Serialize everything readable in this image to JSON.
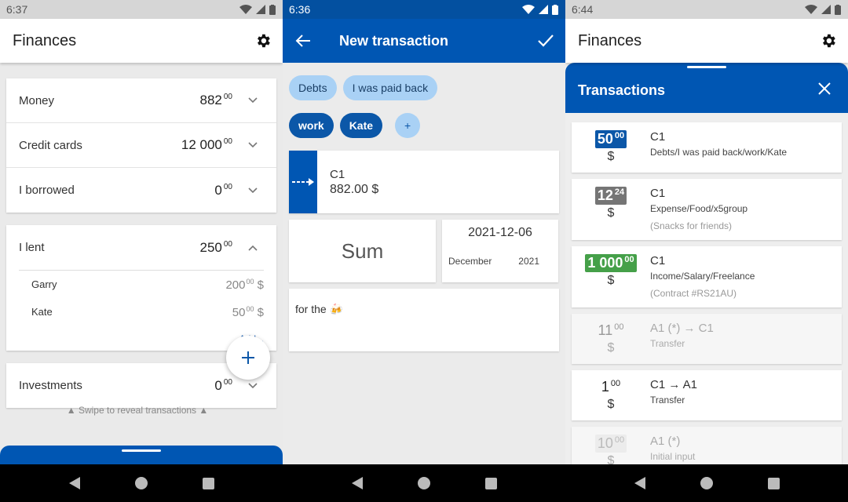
{
  "screen1": {
    "status_time": "6:37",
    "title": "Finances",
    "accounts": [
      {
        "label": "Money",
        "amount": "882",
        "cents": "00"
      },
      {
        "label": "Credit cards",
        "amount": "12 000",
        "cents": "00"
      },
      {
        "label": "I borrowed",
        "amount": "0",
        "cents": "00"
      }
    ],
    "lent": {
      "label": "I lent",
      "amount": "250",
      "cents": "00",
      "items": [
        {
          "name": "Garry",
          "amount": "200",
          "cents": "00",
          "currency": "$"
        },
        {
          "name": "Kate",
          "amount": "50",
          "cents": "00",
          "currency": "$"
        }
      ],
      "add_label": "Add..."
    },
    "investments": {
      "label": "Investments",
      "amount": "0",
      "cents": "00"
    },
    "swipe_hint": "▲ Swipe to reveal transactions ▲",
    "fab_label": "+"
  },
  "screen2": {
    "status_time": "6:36",
    "title": "New transaction",
    "chips_row1": [
      "Debts",
      "I was paid back"
    ],
    "chips_row2": [
      "work",
      "Kate"
    ],
    "chip_add": "+",
    "account_name": "C1",
    "account_balance": "882.00 $",
    "sum_placeholder": "Sum",
    "date": "2021-12-06",
    "month": "December",
    "year": "2021",
    "note": "for the 🍻"
  },
  "screen3": {
    "status_time": "6:44",
    "title": "Finances",
    "sheet_title": "Transactions",
    "transactions": [
      {
        "amount": "50",
        "cents": "00",
        "currency": "$",
        "style": "blue",
        "account": "C1",
        "category": "Debts/I was paid back/work/Kate",
        "note": "",
        "faded": false
      },
      {
        "amount": "12",
        "cents": "24",
        "currency": "$",
        "style": "grey",
        "account": "C1",
        "category": "Expense/Food/x5group",
        "note": "(Snacks for friends)",
        "faded": false
      },
      {
        "amount": "1 000",
        "cents": "00",
        "currency": "$",
        "style": "green",
        "account": "C1",
        "category": "Income/Salary/Freelance",
        "note": "(Contract #RS21AU)",
        "faded": false
      },
      {
        "amount": "11",
        "cents": "00",
        "currency": "$",
        "style": "faded",
        "account": "A1 (*) → C1",
        "category": "Transfer",
        "note": "",
        "faded": true
      },
      {
        "amount": "1",
        "cents": "00",
        "currency": "$",
        "style": "plain",
        "account": "C1 → A1",
        "category": "Transfer",
        "note": "",
        "faded": false
      },
      {
        "amount": "10",
        "cents": "00",
        "currency": "$",
        "style": "faded2",
        "account": "A1 (*)",
        "category": "Initial input",
        "note": "",
        "faded": true
      }
    ]
  },
  "colors": {
    "primary": "#0056b3",
    "chip_light": "#a9d1f5",
    "income": "#45a049",
    "expense": "#757575"
  }
}
